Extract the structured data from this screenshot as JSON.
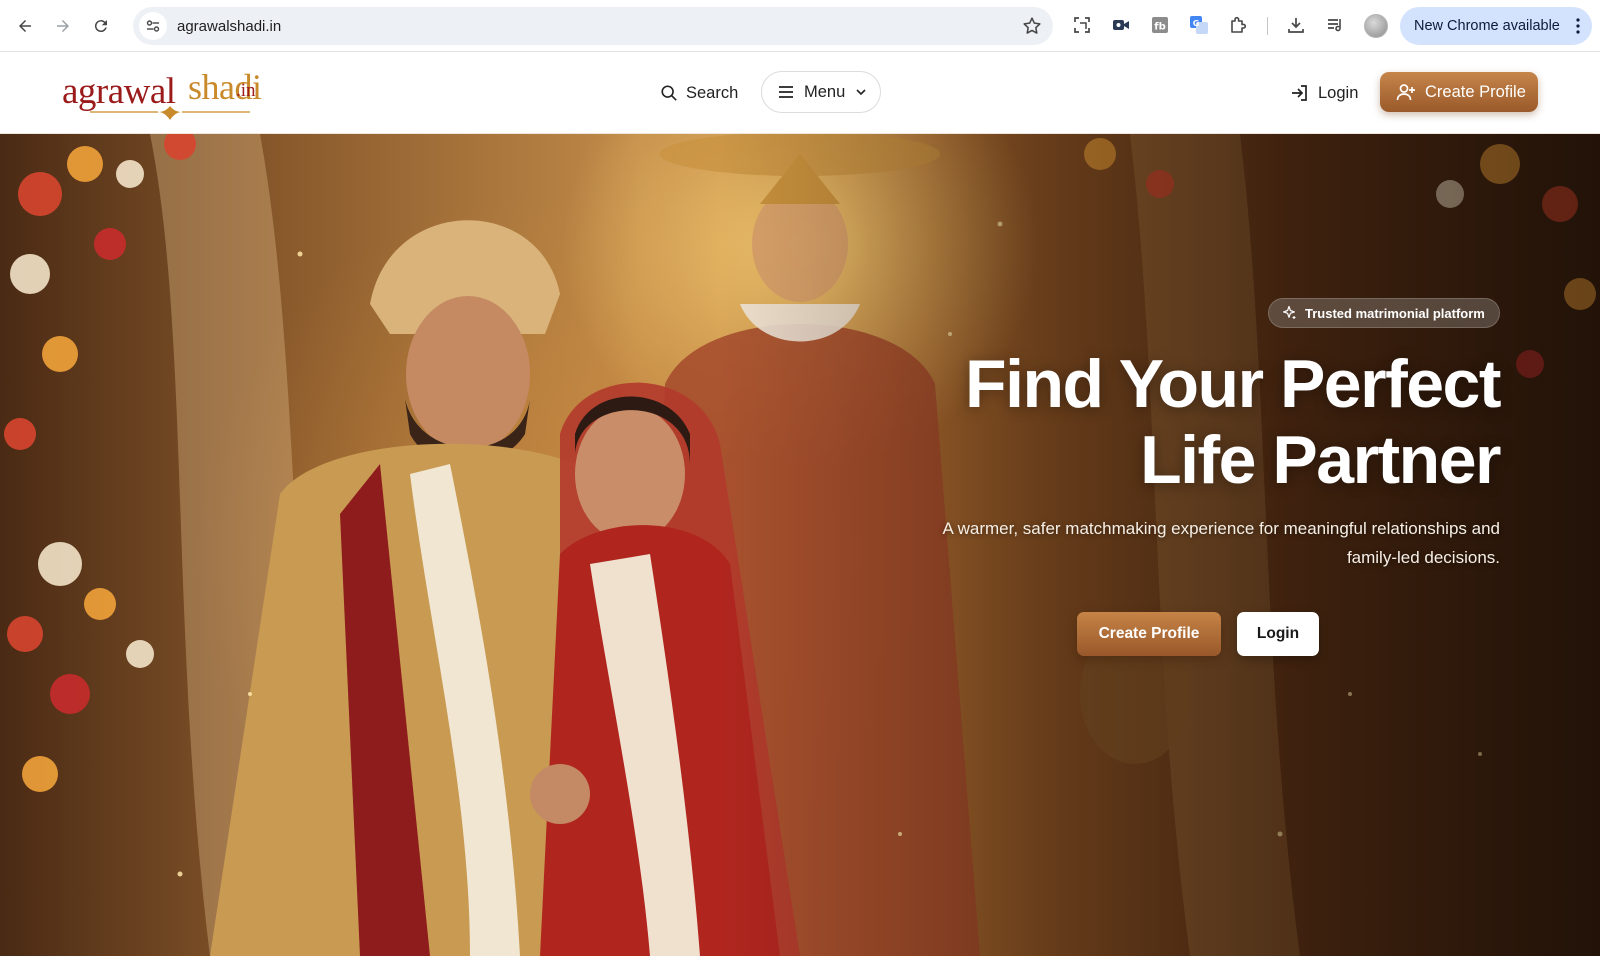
{
  "browser": {
    "url": "agrawalshadi.in",
    "update_label": "New Chrome available",
    "icons": [
      "back-icon",
      "forward-icon",
      "reload-icon",
      "site-info-icon",
      "bookmark-star-icon",
      "screenshot-icon",
      "video-icon",
      "extension-fb-icon",
      "translate-icon",
      "extensions-puzzle-icon",
      "download-icon",
      "reading-list-icon",
      "profile-avatar",
      "more-vert-icon"
    ]
  },
  "header": {
    "logo": {
      "part1": "agrawal",
      "part2": "shadi",
      "part3": ".in"
    },
    "search_label": "Search",
    "menu_label": "Menu",
    "login_label": "Login",
    "create_profile_label": "Create Profile"
  },
  "hero": {
    "badge": "Trusted matrimonial platform",
    "title_line1": "Find Your Perfect",
    "title_line2": "Life Partner",
    "subtitle": "A warmer, safer matchmaking experience for meaningful relationships and family-led decisions.",
    "cta_primary": "Create Profile",
    "cta_secondary": "Login"
  },
  "colors": {
    "brand_maroon": "#9b1b1b",
    "brand_gold": "#c98a2b",
    "cta_gradient_top": "#c6854a",
    "cta_gradient_bottom": "#9a5a2a",
    "chrome_update_pill": "#d3e3fd",
    "omnibox_bg": "#edf0f5"
  }
}
